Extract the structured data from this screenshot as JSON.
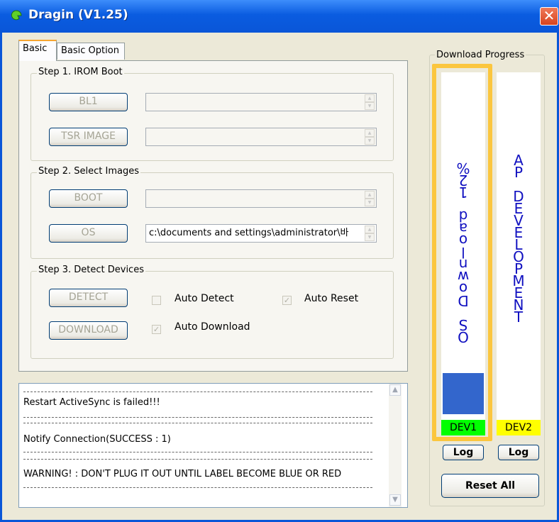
{
  "window": {
    "title": "Dragin (V1.25)",
    "close_glyph": "✕"
  },
  "tabs": [
    {
      "label": "Basic",
      "active": true
    },
    {
      "label": "Basic Option",
      "active": false
    }
  ],
  "step1": {
    "title": "Step 1. IROM Boot",
    "bl1_label": "BL1",
    "bl1_value": "",
    "tsr_label": "TSR IMAGE",
    "tsr_value": ""
  },
  "step2": {
    "title": "Step 2. Select Images",
    "boot_label": "BOOT",
    "boot_value": "",
    "os_label": "OS",
    "os_value": "c:\\documents and settings\\administrator\\바"
  },
  "step3": {
    "title": "Step 3. Detect Devices",
    "detect_label": "DETECT",
    "download_label": "DOWNLOAD",
    "auto_detect": {
      "label": "Auto Detect",
      "checked": false
    },
    "auto_reset": {
      "label": "Auto Reset",
      "checked": true
    },
    "auto_download": {
      "label": "Auto Download",
      "checked": true
    }
  },
  "log": {
    "separator": "------------------------------------------------------------------------------------------------------------",
    "lines": [
      "Restart ActiveSync is failed!!!",
      "Notify Connection(SUCCESS : 1)",
      "WARNING! : DON'T PLUG IT OUT UNTIL LABEL BECOME BLUE OR RED"
    ]
  },
  "download_progress": {
    "title": "Download Progress",
    "devices": [
      {
        "label": "DEV1",
        "status_text": "OS Download 12%",
        "progress": 0.12,
        "label_color": "#00ff00",
        "bar_color": "#3366cc"
      },
      {
        "label": "DEV2",
        "status_text": "AP DEVELOPMENT",
        "progress": 0,
        "label_color": "#ffff00",
        "bar_color": "#3366cc"
      }
    ],
    "log_label": "Log",
    "reset_all_label": "Reset All"
  },
  "colors": {
    "title_bar": "#0a56d8",
    "highlight": "#fbc63e"
  }
}
